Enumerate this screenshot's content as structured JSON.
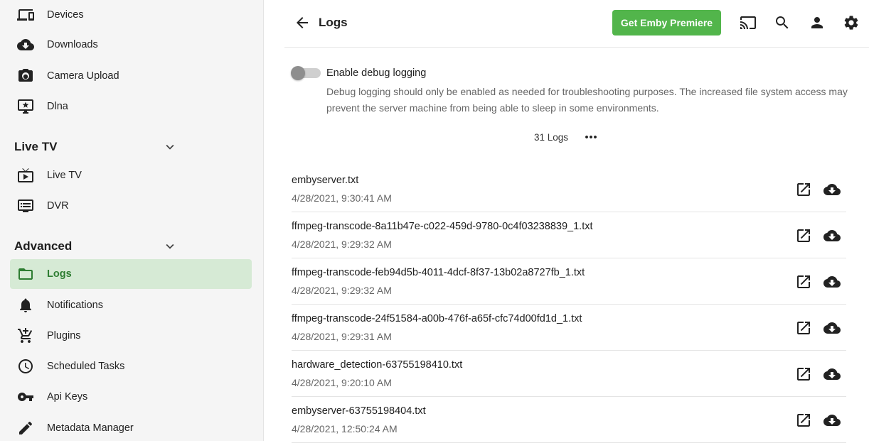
{
  "sidebar": {
    "items_top": [
      {
        "label": "Devices",
        "icon": "devices-icon"
      },
      {
        "label": "Downloads",
        "icon": "cloud-download-icon"
      },
      {
        "label": "Camera Upload",
        "icon": "camera-icon"
      },
      {
        "label": "Dlna",
        "icon": "dlna-icon"
      }
    ],
    "live_tv": {
      "title": "Live TV",
      "items": [
        {
          "label": "Live TV",
          "icon": "live-tv-icon"
        },
        {
          "label": "DVR",
          "icon": "dvr-icon"
        }
      ]
    },
    "advanced": {
      "title": "Advanced",
      "items": [
        {
          "label": "Logs",
          "icon": "folder-icon",
          "active": true
        },
        {
          "label": "Notifications",
          "icon": "bell-icon"
        },
        {
          "label": "Plugins",
          "icon": "add-shopping-cart-icon"
        },
        {
          "label": "Scheduled Tasks",
          "icon": "clock-icon"
        },
        {
          "label": "Api Keys",
          "icon": "key-icon"
        },
        {
          "label": "Metadata Manager",
          "icon": "pencil-icon"
        }
      ]
    }
  },
  "header": {
    "title": "Logs",
    "premiere_label": "Get Emby Premiere"
  },
  "debug": {
    "label": "Enable debug logging",
    "enabled": false,
    "description": "Debug logging should only be enabled as needed for troubleshooting purposes. The increased file system access may prevent the server machine from being able to sleep in some environments."
  },
  "logs_count_label": "31 Logs",
  "logs": [
    {
      "name": "embyserver.txt",
      "date": "4/28/2021, 9:30:41 AM"
    },
    {
      "name": "ffmpeg-transcode-8a11b47e-c022-459d-9780-0c4f03238839_1.txt",
      "date": "4/28/2021, 9:29:32 AM"
    },
    {
      "name": "ffmpeg-transcode-feb94d5b-4011-4dcf-8f37-13b02a8727fb_1.txt",
      "date": "4/28/2021, 9:29:32 AM"
    },
    {
      "name": "ffmpeg-transcode-24f51584-a00b-476f-a65f-cfc74d00fd1d_1.txt",
      "date": "4/28/2021, 9:29:31 AM"
    },
    {
      "name": "hardware_detection-63755198410.txt",
      "date": "4/28/2021, 9:20:10 AM"
    },
    {
      "name": "embyserver-63755198404.txt",
      "date": "4/28/2021, 12:50:24 AM"
    }
  ],
  "colors": {
    "accent": "#52b54b",
    "active_bg": "#d6ead5",
    "active_text": "#2e7d32"
  }
}
